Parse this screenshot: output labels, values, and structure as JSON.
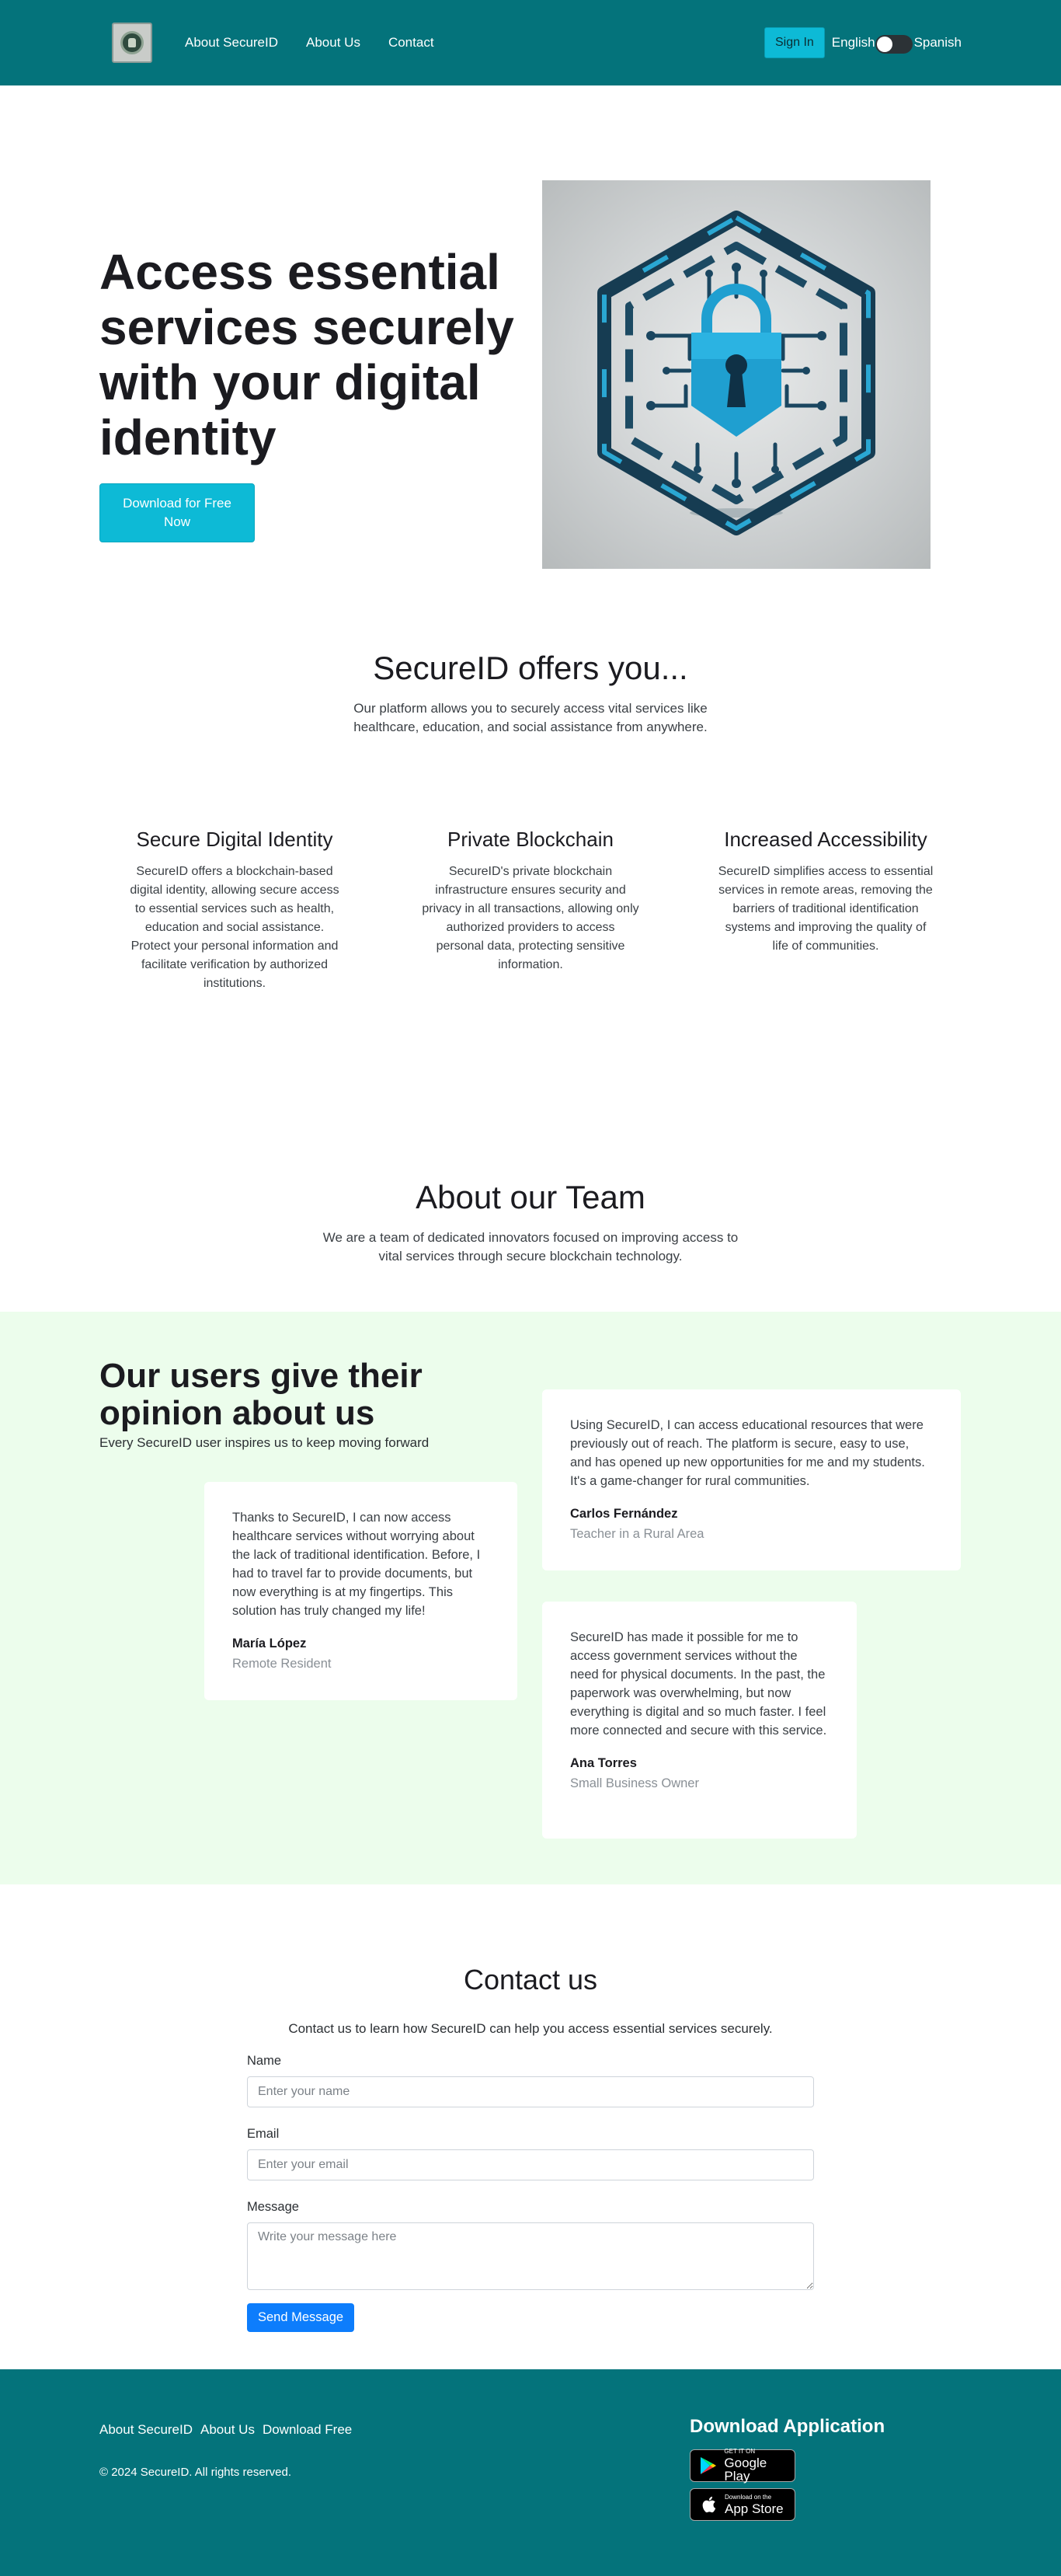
{
  "header": {
    "nav": [
      "About SecureID",
      "About Us",
      "Contact"
    ],
    "signin_label": "Sign In",
    "lang_en": "English",
    "lang_es": "Spanish",
    "logo_icon": "emblem-logo"
  },
  "hero": {
    "title": "Access essential services securely with your digital identity",
    "cta_label": "Download for Free Now",
    "image_icon": "blockchain-padlock-illustration"
  },
  "offers": {
    "title": "SecureID offers you...",
    "intro": "Our platform allows you to securely access vital services like healthcare, education, and social assistance from anywhere.",
    "features": [
      {
        "title": "Secure Digital Identity",
        "text": "SecureID offers a blockchain-based digital identity, allowing secure access to essential services such as health, education and social assistance. Protect your personal information and facilitate verification by authorized institutions."
      },
      {
        "title": "Private Blockchain",
        "text": "SecureID's private blockchain infrastructure ensures security and privacy in all transactions, allowing only authorized providers to access personal data, protecting sensitive information."
      },
      {
        "title": "Increased Accessibility",
        "text": "SecureID simplifies access to essential services in remote areas, removing the barriers of traditional identification systems and improving the quality of life of communities."
      }
    ]
  },
  "team": {
    "title": "About our Team",
    "text": "We are a team of dedicated innovators focused on improving access to vital services through secure blockchain technology."
  },
  "testimonials": {
    "title": "Our users give their opinion about us",
    "subtitle": "Every SecureID user inspires us to keep moving forward",
    "items": [
      {
        "quote": "Using SecureID, I can access educational resources that were previously out of reach. The platform is secure, easy to use, and has opened up new opportunities for me and my students. It's a game-changer for rural communities.",
        "name": "Carlos Fernández",
        "role": "Teacher in a Rural Area"
      },
      {
        "quote": "Thanks to SecureID, I can now access healthcare services without worrying about the lack of traditional identification. Before, I had to travel far to provide documents, but now everything is at my fingertips. This solution has truly changed my life!",
        "name": "María López",
        "role": "Remote Resident"
      },
      {
        "quote": "SecureID has made it possible for me to access government services without the need for physical documents. In the past, the paperwork was overwhelming, but now everything is digital and so much faster. I feel more connected and secure with this service.",
        "name": "Ana Torres",
        "role": "Small Business Owner"
      }
    ]
  },
  "contact": {
    "title": "Contact us",
    "intro": "Contact us to learn how SecureID can help you access essential services securely.",
    "name_label": "Name",
    "name_placeholder": "Enter your name",
    "email_label": "Email",
    "email_placeholder": "Enter your email",
    "message_label": "Message",
    "message_placeholder": "Write your message here",
    "send_label": "Send Message"
  },
  "footer": {
    "links": [
      "About SecureID",
      "About Us",
      "Download Free"
    ],
    "copyright": "© 2024 SecureID. All rights reserved.",
    "download_title": "Download Application",
    "google_small": "GET IT ON",
    "google_big": "Google Play",
    "apple_small": "Download on the",
    "apple_big": "App Store"
  },
  "colors": {
    "brand_teal": "#04737b",
    "accent_cyan": "#0dbad6",
    "testimonial_bg": "#ecfdec",
    "send_blue": "#0d7dfc"
  }
}
